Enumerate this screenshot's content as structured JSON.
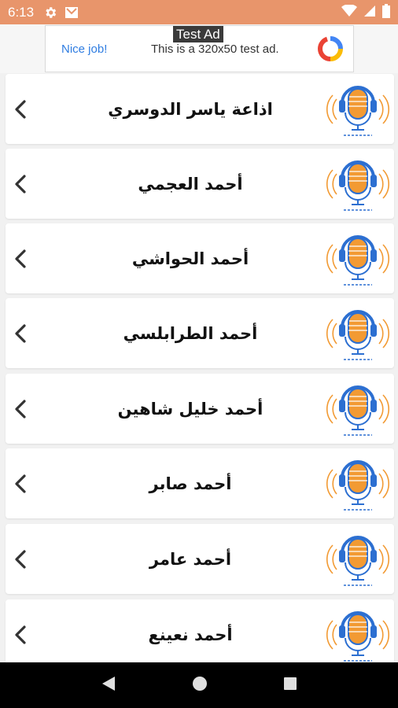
{
  "status": {
    "time": "6:13"
  },
  "ad": {
    "tag": "Test Ad",
    "nice": "Nice job!",
    "text": "This is a 320x50 test ad."
  },
  "reciters": [
    {
      "name": "اذاعة ياسر الدوسري"
    },
    {
      "name": "أحمد العجمي"
    },
    {
      "name": "أحمد الحواشي"
    },
    {
      "name": "أحمد الطرابلسي"
    },
    {
      "name": "أحمد خليل شاهين"
    },
    {
      "name": "أحمد صابر"
    },
    {
      "name": "أحمد عامر"
    },
    {
      "name": "أحمد نعينع"
    }
  ],
  "colors": {
    "status_bar": "#e8956b",
    "mic_orange": "#f29a33",
    "mic_blue": "#2c6fd1"
  },
  "icons": {
    "row_chevron": "chevron-left-icon",
    "row_logo": "microphone-logo-icon"
  }
}
